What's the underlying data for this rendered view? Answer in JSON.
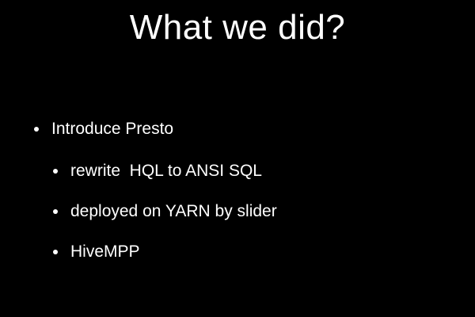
{
  "slide": {
    "title": "What we did?",
    "bullets": [
      {
        "text": "Introduce Presto",
        "level": 1
      },
      {
        "text": "rewrite  HQL to ANSI SQL",
        "level": 2
      },
      {
        "text": "deployed on YARN by slider",
        "level": 2
      },
      {
        "text": "HiveMPP",
        "level": 2
      }
    ]
  }
}
